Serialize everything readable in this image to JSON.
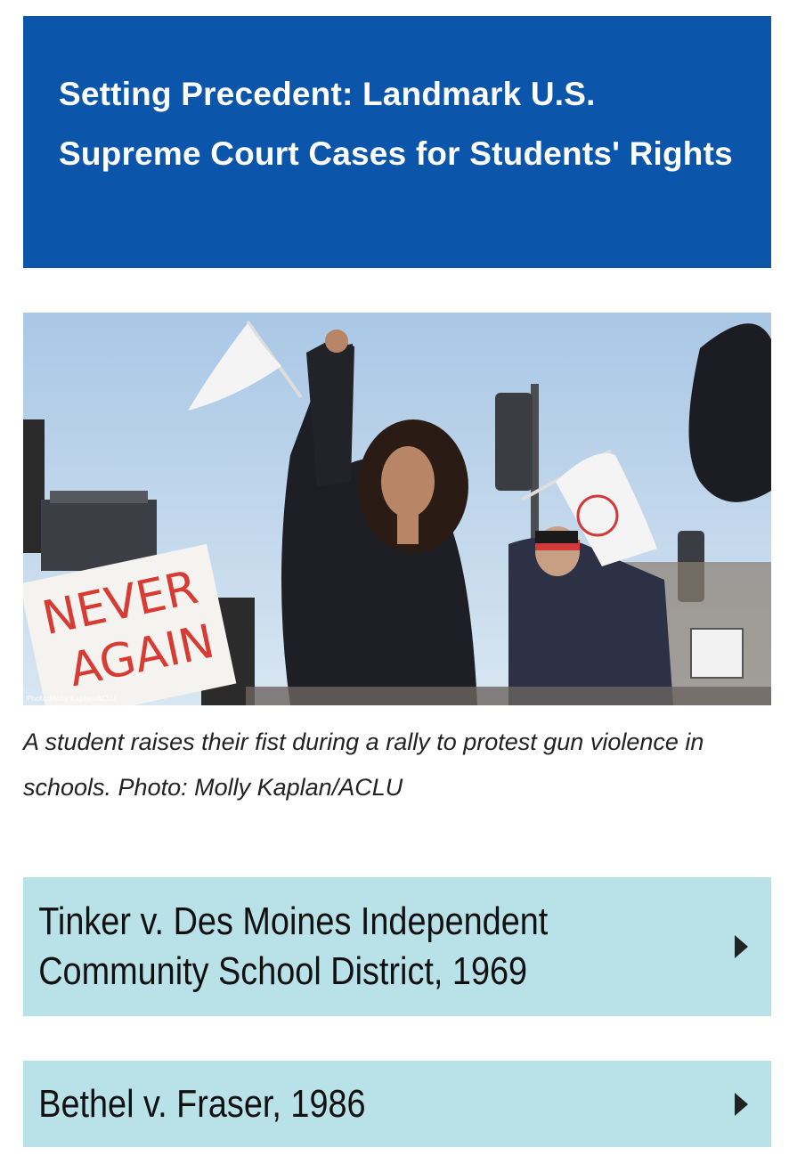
{
  "header": {
    "title": "Setting Precedent: Landmark U.S. Supreme Court Cases for Students' Rights",
    "background_color": "#0b55ab"
  },
  "photo": {
    "credit": "Photo:Molly Kaplan/ACLU",
    "sign_text_line1": "NEVER",
    "sign_text_line2": "AGAIN"
  },
  "caption": {
    "text": "A student raises their fist during a rally to protest gun violence in schools. Photo: Molly Kaplan/ACLU"
  },
  "accordion": {
    "items": [
      {
        "label": "Tinker v. Des Moines Independent Community School District, 1969",
        "icon": "caret-right-icon"
      },
      {
        "label": "Bethel v. Fraser, 1986",
        "icon": "caret-right-icon"
      }
    ],
    "background_color": "#b9e1e8"
  }
}
